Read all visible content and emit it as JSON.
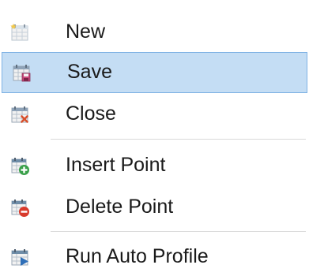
{
  "menu": {
    "items": [
      {
        "label": "New",
        "icon": "calendar-new-icon",
        "highlighted": false
      },
      {
        "label": "Save",
        "icon": "calendar-save-icon",
        "highlighted": true
      },
      {
        "label": "Close",
        "icon": "calendar-close-icon",
        "highlighted": false
      },
      {
        "label": "Insert Point",
        "icon": "calendar-insert-point-icon",
        "highlighted": false
      },
      {
        "label": "Delete Point",
        "icon": "calendar-delete-point-icon",
        "highlighted": false
      },
      {
        "label": "Run Auto Profile",
        "icon": "calendar-run-icon",
        "highlighted": false
      }
    ]
  },
  "colors": {
    "highlight_bg": "#c4ddf4",
    "highlight_border": "#7fb2e4",
    "separator": "#d9d9d9",
    "add_green": "#3aa04a",
    "delete_red": "#d83a2c",
    "close_red": "#d8502c",
    "run_blue": "#2f6fb8"
  }
}
